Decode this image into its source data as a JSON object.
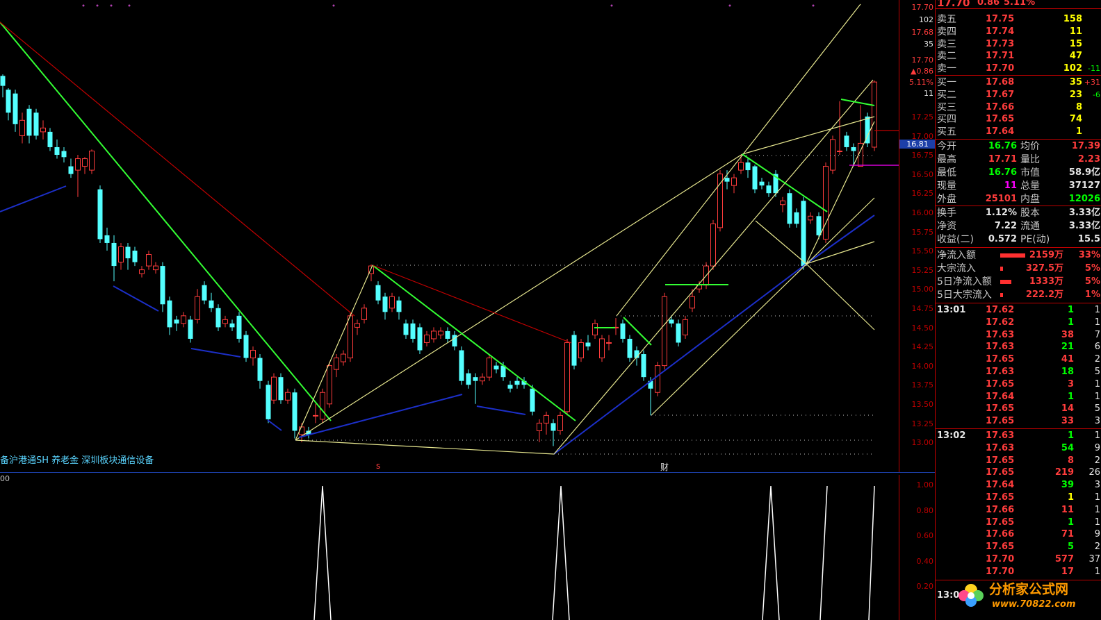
{
  "header": {
    "price": "17.70",
    "change": "0.86",
    "pct": "5.11%"
  },
  "axis": {
    "top_labels": [
      "17.70",
      "102",
      "17.68",
      "35",
      "17.70",
      "▲0.86",
      "5.11%",
      "11"
    ],
    "price_ticks": [
      "17.25",
      "17.00",
      "16.75",
      "16.50",
      "16.25",
      "16.00",
      "15.75",
      "15.50",
      "15.25",
      "15.00",
      "14.75",
      "14.50",
      "14.25",
      "14.00",
      "13.75",
      "13.50",
      "13.25",
      "13.00"
    ],
    "cursor_price": "16.81",
    "sub_ticks": [
      "1.00",
      "0.80",
      "0.60",
      "0.40",
      "0.20"
    ],
    "left_label": "00"
  },
  "chart": {
    "ticker_text": "备沪港通SH 养老金 深圳板块通信设备",
    "marker_s": "s",
    "marker_cai": "财"
  },
  "order_book": {
    "asks": [
      {
        "label": "卖五",
        "price": "17.75",
        "vol": "158",
        "chg": ""
      },
      {
        "label": "卖四",
        "price": "17.74",
        "vol": "11",
        "chg": ""
      },
      {
        "label": "卖三",
        "price": "17.73",
        "vol": "15",
        "chg": ""
      },
      {
        "label": "卖二",
        "price": "17.71",
        "vol": "47",
        "chg": ""
      },
      {
        "label": "卖一",
        "price": "17.70",
        "vol": "102",
        "chg": "-11"
      }
    ],
    "bids": [
      {
        "label": "买一",
        "price": "17.68",
        "vol": "35",
        "chg": "+31"
      },
      {
        "label": "买二",
        "price": "17.67",
        "vol": "23",
        "chg": "-6"
      },
      {
        "label": "买三",
        "price": "17.66",
        "vol": "8",
        "chg": ""
      },
      {
        "label": "买四",
        "price": "17.65",
        "vol": "74",
        "chg": ""
      },
      {
        "label": "买五",
        "price": "17.64",
        "vol": "1",
        "chg": ""
      }
    ]
  },
  "stats": [
    {
      "l1": "今开",
      "v1": "16.76",
      "l2": "均价",
      "v2": "17.39"
    },
    {
      "l1": "最高",
      "v1": "17.71",
      "l2": "量比",
      "v2": "2.23"
    },
    {
      "l1": "最低",
      "v1": "16.76",
      "l2": "市值",
      "v2": "58.9亿"
    },
    {
      "l1": "现量",
      "v1": "11",
      "l2": "总量",
      "v2": "37127"
    },
    {
      "l1": "外盘",
      "v1": "25101",
      "l2": "内盘",
      "v2": "12026"
    }
  ],
  "fundamentals": [
    {
      "l1": "换手",
      "v1": "1.12%",
      "l2": "股本",
      "v2": "3.33亿"
    },
    {
      "l1": "净资",
      "v1": "7.22",
      "l2": "流通",
      "v2": "3.33亿"
    },
    {
      "l1": "收益(二)",
      "v1": "0.572",
      "l2": "PE(动)",
      "v2": "15.5"
    }
  ],
  "flows": [
    {
      "label": "净流入额",
      "bar": 0.9,
      "value": "2159万",
      "pct": "33%"
    },
    {
      "label": "大宗流入",
      "bar": 0.1,
      "value": "327.5万",
      "pct": "5%"
    },
    {
      "label": "5日净流入额",
      "bar": 0.4,
      "value": "1333万",
      "pct": "5%"
    },
    {
      "label": "5日大宗流入",
      "bar": 0.1,
      "value": "222.2万",
      "pct": "1%"
    }
  ],
  "ticks": [
    {
      "time": "13:01",
      "price": "17.62",
      "vol": "1",
      "n": "1",
      "dir": "g"
    },
    {
      "time": "",
      "price": "17.62",
      "vol": "1",
      "n": "1",
      "dir": "g"
    },
    {
      "time": "",
      "price": "17.63",
      "vol": "38",
      "n": "7",
      "dir": "r"
    },
    {
      "time": "",
      "price": "17.63",
      "vol": "21",
      "n": "6",
      "dir": "g"
    },
    {
      "time": "",
      "price": "17.65",
      "vol": "41",
      "n": "2",
      "dir": "r"
    },
    {
      "time": "",
      "price": "17.63",
      "vol": "18",
      "n": "5",
      "dir": "g"
    },
    {
      "time": "",
      "price": "17.65",
      "vol": "3",
      "n": "1",
      "dir": "r"
    },
    {
      "time": "",
      "price": "17.64",
      "vol": "1",
      "n": "1",
      "dir": "g"
    },
    {
      "time": "",
      "price": "17.65",
      "vol": "14",
      "n": "5",
      "dir": "r"
    },
    {
      "time": "",
      "price": "17.65",
      "vol": "33",
      "n": "3",
      "dir": "r"
    },
    {
      "time": "13:02",
      "price": "17.63",
      "vol": "1",
      "n": "1",
      "dir": "g"
    },
    {
      "time": "",
      "price": "17.63",
      "vol": "54",
      "n": "9",
      "dir": "g"
    },
    {
      "time": "",
      "price": "17.65",
      "vol": "8",
      "n": "2",
      "dir": "r"
    },
    {
      "time": "",
      "price": "17.65",
      "vol": "219",
      "n": "26",
      "dir": "r"
    },
    {
      "time": "",
      "price": "17.64",
      "vol": "39",
      "n": "3",
      "dir": "g"
    },
    {
      "time": "",
      "price": "17.65",
      "vol": "1",
      "n": "1",
      "dir": "y"
    },
    {
      "time": "",
      "price": "17.66",
      "vol": "11",
      "n": "1",
      "dir": "r"
    },
    {
      "time": "",
      "price": "17.65",
      "vol": "1",
      "n": "1",
      "dir": "g"
    },
    {
      "time": "",
      "price": "17.66",
      "vol": "71",
      "n": "9",
      "dir": "r"
    },
    {
      "time": "",
      "price": "17.65",
      "vol": "5",
      "n": "2",
      "dir": "g"
    },
    {
      "time": "",
      "price": "17.70",
      "vol": "577",
      "n": "37",
      "dir": "r"
    },
    {
      "time": "",
      "price": "17.70",
      "vol": "17",
      "n": "1",
      "dir": "r"
    },
    {
      "time": "13:0",
      "price": "",
      "vol": "",
      "n": "",
      "dir": "r"
    }
  ],
  "logo": {
    "text": "分析家公式网",
    "url": "www.70822.com"
  }
}
